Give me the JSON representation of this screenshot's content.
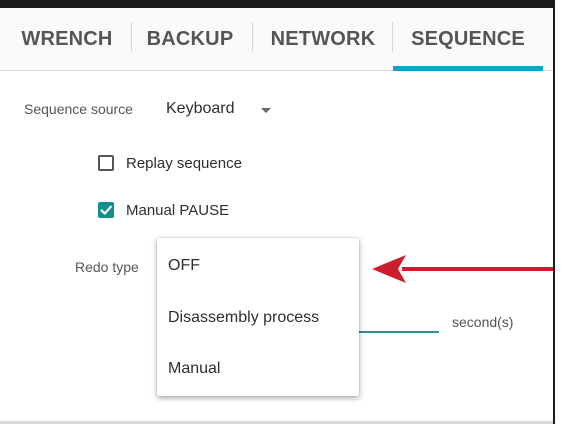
{
  "tabs": [
    {
      "label": "WRENCH",
      "active": false
    },
    {
      "label": "BACKUP",
      "active": false
    },
    {
      "label": "NETWORK",
      "active": false
    },
    {
      "label": "SEQUENCE",
      "active": true
    }
  ],
  "sequence_source": {
    "label": "Sequence source",
    "value": "Keyboard"
  },
  "checkboxes": {
    "replay": {
      "label": "Replay sequence",
      "checked": false
    },
    "manual_pause": {
      "label": "Manual PAUSE",
      "checked": true
    }
  },
  "redo_type": {
    "label": "Redo type",
    "options": [
      "OFF",
      "Disassembly process",
      "Manual"
    ]
  },
  "seconds_unit": "second(s)",
  "colors": {
    "accent_tab": "#1aa0cf",
    "teal": "#138f8a",
    "annotation_arrow": "#cc1e2a"
  }
}
